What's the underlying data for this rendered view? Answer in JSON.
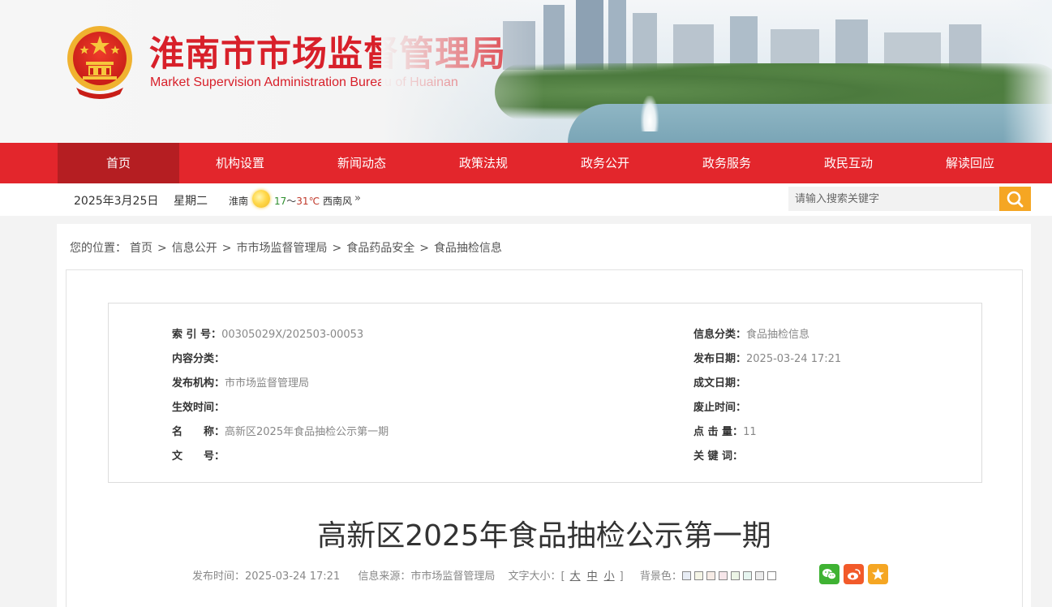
{
  "header": {
    "title": "淮南市市场监督管理局",
    "subtitle": "Market Supervision Administration Bureau of Huainan"
  },
  "nav": {
    "items": [
      {
        "label": "首页",
        "active": true
      },
      {
        "label": "机构设置"
      },
      {
        "label": "新闻动态"
      },
      {
        "label": "政策法规"
      },
      {
        "label": "政务公开"
      },
      {
        "label": "政务服务"
      },
      {
        "label": "政民互动"
      },
      {
        "label": "解读回应"
      }
    ]
  },
  "infobar": {
    "date": "2025年3月25日",
    "weekday": "星期二",
    "weather": {
      "city": "淮南",
      "icon": "sun-icon",
      "temp_low": "17",
      "temp_sep": "～",
      "temp_high": "31℃",
      "wind": "西南风",
      "more": "»"
    },
    "search": {
      "placeholder": "请输入搜索关键字",
      "icon": "search-icon"
    }
  },
  "breadcrumb": {
    "prefix": "您的位置：",
    "items": [
      "首页",
      "信息公开",
      "市市场监督管理局",
      "食品药品安全",
      "食品抽检信息"
    ],
    "separator": ">"
  },
  "meta": {
    "left": [
      {
        "key": "索 引 号：",
        "value": "00305029X/202503-00053"
      },
      {
        "key": "内容分类：",
        "value": ""
      },
      {
        "key": "发布机构：",
        "value": "市市场监督管理局"
      },
      {
        "key": "生效时间：",
        "value": ""
      },
      {
        "key": "名　　称：",
        "value": "高新区2025年食品抽检公示第一期"
      },
      {
        "key": "文　　号：",
        "value": ""
      }
    ],
    "right": [
      {
        "key": "信息分类：",
        "value": "食品抽检信息"
      },
      {
        "key": "发布日期：",
        "value": "2025-03-24 17:21"
      },
      {
        "key": "成文日期：",
        "value": ""
      },
      {
        "key": "废止时间：",
        "value": ""
      },
      {
        "key": "点 击 量：",
        "value": "11"
      },
      {
        "key": "关 键 词：",
        "value": ""
      }
    ]
  },
  "article": {
    "title": "高新区2025年食品抽检公示第一期",
    "publish_label": "发布时间：",
    "publish_time": "2025-03-24 17:21",
    "source_label": "信息来源：",
    "source": "市市场监督管理局",
    "fontsize_label": "文字大小：",
    "fontsize_open": "[",
    "fontsize_large": "大",
    "fontsize_medium": "中",
    "fontsize_small": "小",
    "fontsize_close": "]",
    "bg_label": "背景色：",
    "bg_colors": [
      "#e8edf5",
      "#f5f5e6",
      "#f7ece6",
      "#f7e6ea",
      "#ecf5e6",
      "#e6f5f0",
      "#ececec",
      "#ffffff"
    ],
    "share": [
      {
        "name": "wechat-share-icon",
        "color": "#3fb233"
      },
      {
        "name": "weibo-share-icon",
        "color": "#f25a2a"
      },
      {
        "name": "qzone-share-icon",
        "color": "#f5a623"
      }
    ]
  }
}
